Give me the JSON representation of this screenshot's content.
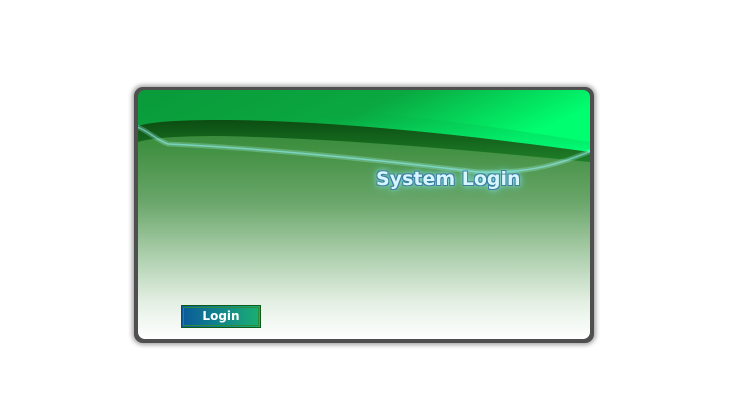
{
  "window": {
    "title": "System Login"
  },
  "actions": {
    "login_label": "Login"
  },
  "colors": {
    "header_green": "#0a9a3a",
    "header_bright": "#00ff70",
    "button_blue": "#0a5a9a",
    "button_green": "#1ab070",
    "title_glow": "#9ff0ff"
  }
}
